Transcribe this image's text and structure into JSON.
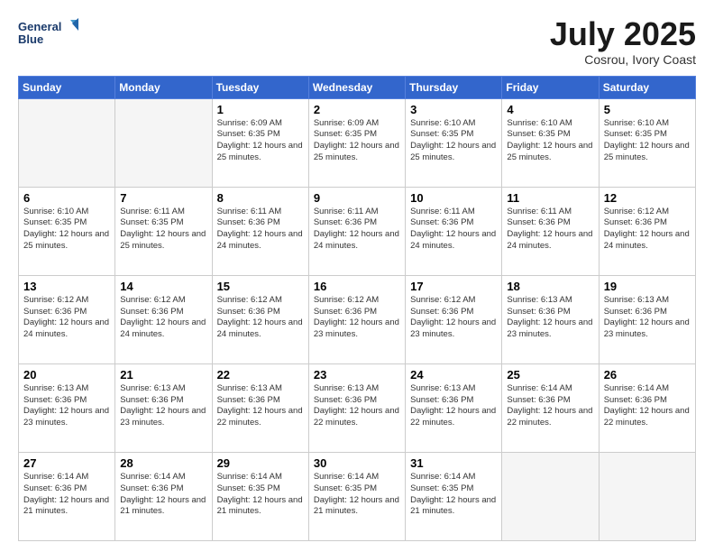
{
  "header": {
    "logo_line1": "General",
    "logo_line2": "Blue",
    "month_title": "July 2025",
    "subtitle": "Cosrou, Ivory Coast"
  },
  "days_of_week": [
    "Sunday",
    "Monday",
    "Tuesday",
    "Wednesday",
    "Thursday",
    "Friday",
    "Saturday"
  ],
  "weeks": [
    [
      {
        "day": "",
        "sunrise": "",
        "sunset": "",
        "daylight": "",
        "empty": true
      },
      {
        "day": "",
        "sunrise": "",
        "sunset": "",
        "daylight": "",
        "empty": true
      },
      {
        "day": "1",
        "sunrise": "Sunrise: 6:09 AM",
        "sunset": "Sunset: 6:35 PM",
        "daylight": "Daylight: 12 hours and 25 minutes.",
        "empty": false
      },
      {
        "day": "2",
        "sunrise": "Sunrise: 6:09 AM",
        "sunset": "Sunset: 6:35 PM",
        "daylight": "Daylight: 12 hours and 25 minutes.",
        "empty": false
      },
      {
        "day": "3",
        "sunrise": "Sunrise: 6:10 AM",
        "sunset": "Sunset: 6:35 PM",
        "daylight": "Daylight: 12 hours and 25 minutes.",
        "empty": false
      },
      {
        "day": "4",
        "sunrise": "Sunrise: 6:10 AM",
        "sunset": "Sunset: 6:35 PM",
        "daylight": "Daylight: 12 hours and 25 minutes.",
        "empty": false
      },
      {
        "day": "5",
        "sunrise": "Sunrise: 6:10 AM",
        "sunset": "Sunset: 6:35 PM",
        "daylight": "Daylight: 12 hours and 25 minutes.",
        "empty": false
      }
    ],
    [
      {
        "day": "6",
        "sunrise": "Sunrise: 6:10 AM",
        "sunset": "Sunset: 6:35 PM",
        "daylight": "Daylight: 12 hours and 25 minutes.",
        "empty": false
      },
      {
        "day": "7",
        "sunrise": "Sunrise: 6:11 AM",
        "sunset": "Sunset: 6:35 PM",
        "daylight": "Daylight: 12 hours and 25 minutes.",
        "empty": false
      },
      {
        "day": "8",
        "sunrise": "Sunrise: 6:11 AM",
        "sunset": "Sunset: 6:36 PM",
        "daylight": "Daylight: 12 hours and 24 minutes.",
        "empty": false
      },
      {
        "day": "9",
        "sunrise": "Sunrise: 6:11 AM",
        "sunset": "Sunset: 6:36 PM",
        "daylight": "Daylight: 12 hours and 24 minutes.",
        "empty": false
      },
      {
        "day": "10",
        "sunrise": "Sunrise: 6:11 AM",
        "sunset": "Sunset: 6:36 PM",
        "daylight": "Daylight: 12 hours and 24 minutes.",
        "empty": false
      },
      {
        "day": "11",
        "sunrise": "Sunrise: 6:11 AM",
        "sunset": "Sunset: 6:36 PM",
        "daylight": "Daylight: 12 hours and 24 minutes.",
        "empty": false
      },
      {
        "day": "12",
        "sunrise": "Sunrise: 6:12 AM",
        "sunset": "Sunset: 6:36 PM",
        "daylight": "Daylight: 12 hours and 24 minutes.",
        "empty": false
      }
    ],
    [
      {
        "day": "13",
        "sunrise": "Sunrise: 6:12 AM",
        "sunset": "Sunset: 6:36 PM",
        "daylight": "Daylight: 12 hours and 24 minutes.",
        "empty": false
      },
      {
        "day": "14",
        "sunrise": "Sunrise: 6:12 AM",
        "sunset": "Sunset: 6:36 PM",
        "daylight": "Daylight: 12 hours and 24 minutes.",
        "empty": false
      },
      {
        "day": "15",
        "sunrise": "Sunrise: 6:12 AM",
        "sunset": "Sunset: 6:36 PM",
        "daylight": "Daylight: 12 hours and 24 minutes.",
        "empty": false
      },
      {
        "day": "16",
        "sunrise": "Sunrise: 6:12 AM",
        "sunset": "Sunset: 6:36 PM",
        "daylight": "Daylight: 12 hours and 23 minutes.",
        "empty": false
      },
      {
        "day": "17",
        "sunrise": "Sunrise: 6:12 AM",
        "sunset": "Sunset: 6:36 PM",
        "daylight": "Daylight: 12 hours and 23 minutes.",
        "empty": false
      },
      {
        "day": "18",
        "sunrise": "Sunrise: 6:13 AM",
        "sunset": "Sunset: 6:36 PM",
        "daylight": "Daylight: 12 hours and 23 minutes.",
        "empty": false
      },
      {
        "day": "19",
        "sunrise": "Sunrise: 6:13 AM",
        "sunset": "Sunset: 6:36 PM",
        "daylight": "Daylight: 12 hours and 23 minutes.",
        "empty": false
      }
    ],
    [
      {
        "day": "20",
        "sunrise": "Sunrise: 6:13 AM",
        "sunset": "Sunset: 6:36 PM",
        "daylight": "Daylight: 12 hours and 23 minutes.",
        "empty": false
      },
      {
        "day": "21",
        "sunrise": "Sunrise: 6:13 AM",
        "sunset": "Sunset: 6:36 PM",
        "daylight": "Daylight: 12 hours and 23 minutes.",
        "empty": false
      },
      {
        "day": "22",
        "sunrise": "Sunrise: 6:13 AM",
        "sunset": "Sunset: 6:36 PM",
        "daylight": "Daylight: 12 hours and 22 minutes.",
        "empty": false
      },
      {
        "day": "23",
        "sunrise": "Sunrise: 6:13 AM",
        "sunset": "Sunset: 6:36 PM",
        "daylight": "Daylight: 12 hours and 22 minutes.",
        "empty": false
      },
      {
        "day": "24",
        "sunrise": "Sunrise: 6:13 AM",
        "sunset": "Sunset: 6:36 PM",
        "daylight": "Daylight: 12 hours and 22 minutes.",
        "empty": false
      },
      {
        "day": "25",
        "sunrise": "Sunrise: 6:14 AM",
        "sunset": "Sunset: 6:36 PM",
        "daylight": "Daylight: 12 hours and 22 minutes.",
        "empty": false
      },
      {
        "day": "26",
        "sunrise": "Sunrise: 6:14 AM",
        "sunset": "Sunset: 6:36 PM",
        "daylight": "Daylight: 12 hours and 22 minutes.",
        "empty": false
      }
    ],
    [
      {
        "day": "27",
        "sunrise": "Sunrise: 6:14 AM",
        "sunset": "Sunset: 6:36 PM",
        "daylight": "Daylight: 12 hours and 21 minutes.",
        "empty": false
      },
      {
        "day": "28",
        "sunrise": "Sunrise: 6:14 AM",
        "sunset": "Sunset: 6:36 PM",
        "daylight": "Daylight: 12 hours and 21 minutes.",
        "empty": false
      },
      {
        "day": "29",
        "sunrise": "Sunrise: 6:14 AM",
        "sunset": "Sunset: 6:35 PM",
        "daylight": "Daylight: 12 hours and 21 minutes.",
        "empty": false
      },
      {
        "day": "30",
        "sunrise": "Sunrise: 6:14 AM",
        "sunset": "Sunset: 6:35 PM",
        "daylight": "Daylight: 12 hours and 21 minutes.",
        "empty": false
      },
      {
        "day": "31",
        "sunrise": "Sunrise: 6:14 AM",
        "sunset": "Sunset: 6:35 PM",
        "daylight": "Daylight: 12 hours and 21 minutes.",
        "empty": false
      },
      {
        "day": "",
        "sunrise": "",
        "sunset": "",
        "daylight": "",
        "empty": true
      },
      {
        "day": "",
        "sunrise": "",
        "sunset": "",
        "daylight": "",
        "empty": true
      }
    ]
  ]
}
